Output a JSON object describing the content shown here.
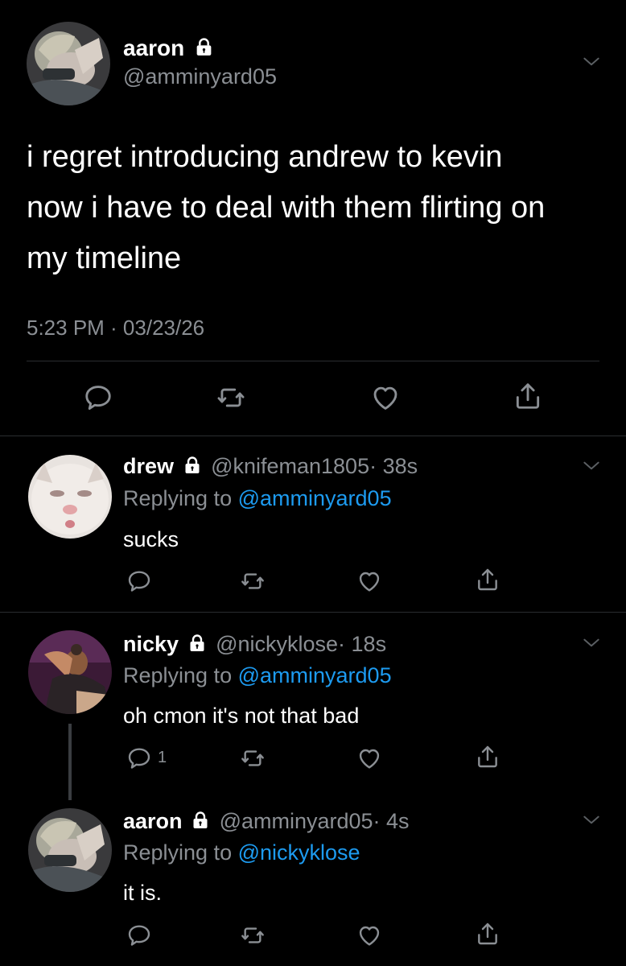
{
  "main_tweet": {
    "name": "aaron",
    "handle": "@amminyard05",
    "text_lines": [
      "i regret introducing andrew to kevin",
      "now i have to deal with them flirting on",
      "my timeline"
    ],
    "timestamp": "5:23 PM · 03/23/26"
  },
  "replies": [
    {
      "name": "drew",
      "handle": "@knifeman1805",
      "age": "· 38s",
      "replying_prefix": "Replying to",
      "replying_to": "@amminyard05",
      "text": "sucks",
      "reply_count": ""
    },
    {
      "name": "nicky",
      "handle": "@nickyklose",
      "age": "· 18s",
      "replying_prefix": "Replying to",
      "replying_to": "@amminyard05",
      "text": "oh cmon it's not that bad",
      "reply_count": "1"
    },
    {
      "name": "aaron",
      "handle": "@amminyard05",
      "age": "· 4s",
      "replying_prefix": "Replying to",
      "replying_to": "@nickyklose",
      "text": "it is.",
      "reply_count": ""
    }
  ],
  "icons": {
    "reply": "reply-icon",
    "retweet": "retweet-icon",
    "like": "heart-icon",
    "share": "share-icon",
    "lock": "lock-icon",
    "menu": "chevron-down-icon"
  },
  "colors": {
    "background": "#000000",
    "link": "#1d9bf0",
    "muted": "#8b8f94",
    "divider": "#2a2d30"
  }
}
